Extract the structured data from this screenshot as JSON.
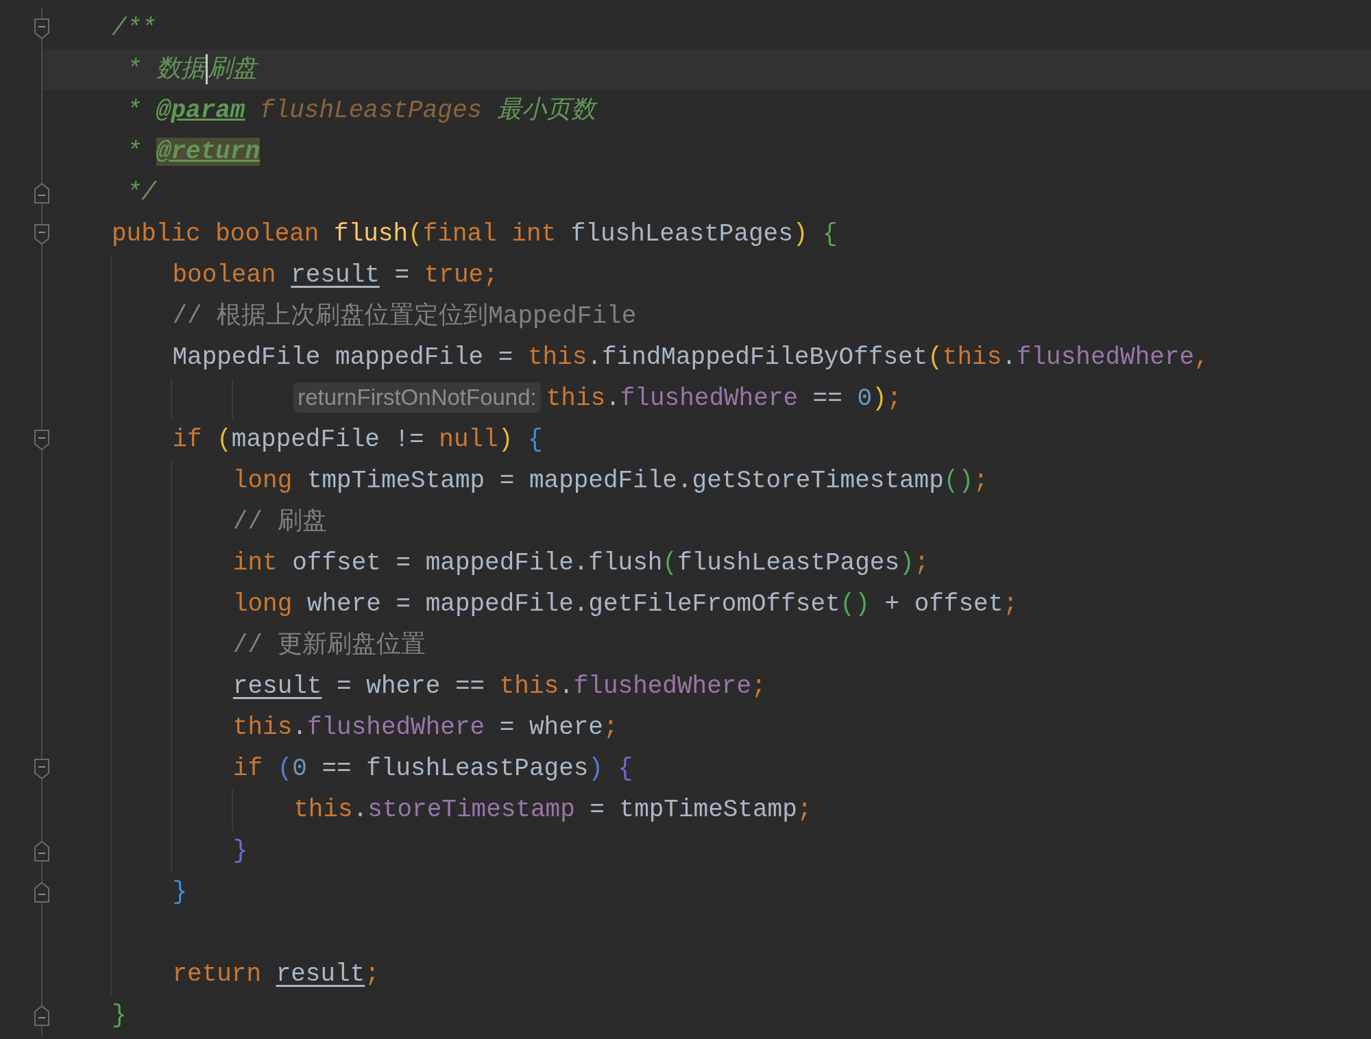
{
  "editor": {
    "lines": [
      {
        "tokens": [
          {
            "kind": "doc",
            "text": "/**"
          }
        ],
        "children": [
          {
            "kind": "doc",
            "current": true,
            "tokens": [
              {
                "kind": "doc",
                "text": "* 数据"
              },
              {
                "kind": "caret"
              },
              {
                "kind": "doc",
                "text": "刷盘"
              }
            ]
          },
          {
            "kind": "doc",
            "tokens": [
              {
                "kind": "doc",
                "text": "* "
              },
              {
                "kind": "doctag",
                "text": "@param",
                "highlighted": false
              },
              {
                "kind": "docparam",
                "text": " flushLeastPages"
              },
              {
                "kind": "doc",
                "text": " 最小页数"
              }
            ]
          },
          {
            "kind": "doc",
            "tokens": [
              {
                "kind": "doc",
                "text": "* "
              },
              {
                "kind": "doctag",
                "text": "@return",
                "highlighted": true
              }
            ]
          },
          {
            "kind": "doc",
            "fold_end": true,
            "tokens": [
              {
                "kind": "doc",
                "text": "*/"
              }
            ]
          }
        ]
      },
      {
        "tokens": [
          {
            "kind": "keyword",
            "text": "public "
          },
          {
            "kind": "keyword",
            "text": "boolean "
          },
          {
            "kind": "method",
            "text": "flush"
          },
          {
            "kind": "bracket",
            "text": "(",
            "color": "#e8ba36"
          },
          {
            "kind": "keyword",
            "text": "final "
          },
          {
            "kind": "keyword",
            "text": "int "
          },
          {
            "kind": "plain",
            "text": "flushLeastPages"
          },
          {
            "kind": "bracket",
            "text": ")",
            "color": "#e8ba36"
          },
          {
            "kind": "bracket",
            "text": " {",
            "color": "#54a857"
          }
        ],
        "children": [
          {
            "kind": "code",
            "tokens": [
              {
                "kind": "keyword",
                "text": "boolean "
              },
              {
                "kind": "variable",
                "text": "result"
              },
              {
                "kind": "plain",
                "text": " = "
              },
              {
                "kind": "keyword",
                "text": "true;"
              }
            ]
          },
          {
            "kind": "code",
            "tokens": [
              {
                "kind": "comment",
                "text": "// 根据上次刷盘位置定位到MappedFile"
              }
            ]
          },
          {
            "kind": "code",
            "tokens": [
              {
                "kind": "plain",
                "text": "MappedFile mappedFile = "
              },
              {
                "kind": "keyword",
                "text": "this"
              },
              {
                "kind": "plain",
                "text": ".findMappedFileByOffset"
              },
              {
                "kind": "bracket",
                "text": "(",
                "color": "#e8ba36"
              },
              {
                "kind": "keyword",
                "text": "this"
              },
              {
                "kind": "plain",
                "text": "."
              },
              {
                "kind": "field",
                "text": "flushedWhere"
              },
              {
                "kind": "keyword",
                "text": ","
              }
            ],
            "children": [
              {
                "kind": "continuation",
                "tokens": [
                  {
                    "kind": "hint",
                    "text": "returnFirstOnNotFound:"
                  },
                  {
                    "kind": "keyword",
                    "text": "this"
                  },
                  {
                    "kind": "plain",
                    "text": "."
                  },
                  {
                    "kind": "field",
                    "text": "flushedWhere"
                  },
                  {
                    "kind": "plain",
                    "text": " == "
                  },
                  {
                    "kind": "number",
                    "text": "0"
                  },
                  {
                    "kind": "bracket",
                    "text": ")",
                    "color": "#e8ba36"
                  },
                  {
                    "kind": "keyword",
                    "text": ";"
                  }
                ]
              }
            ]
          },
          {
            "kind": "code",
            "tokens": [
              {
                "kind": "keyword",
                "text": "if "
              },
              {
                "kind": "bracket",
                "text": "(",
                "color": "#e8ba36"
              },
              {
                "kind": "plain",
                "text": "mappedFile != "
              },
              {
                "kind": "keyword",
                "text": "null"
              },
              {
                "kind": "bracket",
                "text": ")",
                "color": "#e8ba36"
              },
              {
                "kind": "bracket",
                "text": " {",
                "color": "#3d8fe0"
              }
            ],
            "children": [
              {
                "kind": "code",
                "tokens": [
                  {
                    "kind": "keyword",
                    "text": "long "
                  },
                  {
                    "kind": "plain",
                    "text": "tmpTimeStamp = mappedFile.getStoreTimestamp"
                  },
                  {
                    "kind": "bracket",
                    "text": "()",
                    "color": "#54a857"
                  },
                  {
                    "kind": "keyword",
                    "text": ";"
                  }
                ]
              },
              {
                "kind": "code",
                "tokens": [
                  {
                    "kind": "comment",
                    "text": "// 刷盘"
                  }
                ]
              },
              {
                "kind": "code",
                "tokens": [
                  {
                    "kind": "keyword",
                    "text": "int "
                  },
                  {
                    "kind": "plain",
                    "text": "offset = mappedFile.flush"
                  },
                  {
                    "kind": "bracket",
                    "text": "(",
                    "color": "#54a857"
                  },
                  {
                    "kind": "plain",
                    "text": "flushLeastPages"
                  },
                  {
                    "kind": "bracket",
                    "text": ")",
                    "color": "#54a857"
                  },
                  {
                    "kind": "keyword",
                    "text": ";"
                  }
                ]
              },
              {
                "kind": "code",
                "tokens": [
                  {
                    "kind": "keyword",
                    "text": "long "
                  },
                  {
                    "kind": "plain",
                    "text": "where = mappedFile.getFileFromOffset"
                  },
                  {
                    "kind": "bracket",
                    "text": "()",
                    "color": "#54a857"
                  },
                  {
                    "kind": "plain",
                    "text": " + offset"
                  },
                  {
                    "kind": "keyword",
                    "text": ";"
                  }
                ]
              },
              {
                "kind": "code",
                "tokens": [
                  {
                    "kind": "comment",
                    "text": "// 更新刷盘位置"
                  }
                ]
              },
              {
                "kind": "code",
                "tokens": [
                  {
                    "kind": "variable",
                    "text": "result"
                  },
                  {
                    "kind": "plain",
                    "text": " = where == "
                  },
                  {
                    "kind": "keyword",
                    "text": "this"
                  },
                  {
                    "kind": "plain",
                    "text": "."
                  },
                  {
                    "kind": "field",
                    "text": "flushedWhere"
                  },
                  {
                    "kind": "keyword",
                    "text": ";"
                  }
                ]
              },
              {
                "kind": "code",
                "tokens": [
                  {
                    "kind": "keyword",
                    "text": "this"
                  },
                  {
                    "kind": "plain",
                    "text": "."
                  },
                  {
                    "kind": "field",
                    "text": "flushedWhere"
                  },
                  {
                    "kind": "plain",
                    "text": " = where"
                  },
                  {
                    "kind": "keyword",
                    "text": ";"
                  }
                ]
              },
              {
                "kind": "code",
                "tokens": [
                  {
                    "kind": "keyword",
                    "text": "if "
                  },
                  {
                    "kind": "bracket",
                    "text": "(",
                    "color": "#4f7fd6"
                  },
                  {
                    "kind": "number",
                    "text": "0"
                  },
                  {
                    "kind": "plain",
                    "text": " == flushLeastPages"
                  },
                  {
                    "kind": "bracket",
                    "text": ")",
                    "color": "#4f7fd6"
                  },
                  {
                    "kind": "bracket",
                    "text": " {",
                    "color": "#6c6cd8"
                  }
                ],
                "children": [
                  {
                    "kind": "code",
                    "tokens": [
                      {
                        "kind": "keyword",
                        "text": "this"
                      },
                      {
                        "kind": "plain",
                        "text": "."
                      },
                      {
                        "kind": "field",
                        "text": "storeTimestamp"
                      },
                      {
                        "kind": "plain",
                        "text": " = tmpTimeStamp"
                      },
                      {
                        "kind": "keyword",
                        "text": ";"
                      }
                    ]
                  }
                ]
              },
              {
                "kind": "code",
                "fold_end": true,
                "tokens": [
                  {
                    "kind": "bracket",
                    "text": "}",
                    "color": "#6c6cd8"
                  }
                ]
              }
            ]
          },
          {
            "kind": "code",
            "fold_end": true,
            "tokens": [
              {
                "kind": "bracket",
                "text": "}",
                "color": "#3d8fe0"
              }
            ]
          },
          {
            "kind": "code"
          },
          {
            "kind": "code",
            "tokens": [
              {
                "kind": "keyword",
                "text": "return "
              },
              {
                "kind": "variable",
                "text": "result"
              },
              {
                "kind": "keyword",
                "text": ";"
              }
            ]
          }
        ]
      },
      {
        "fold_end": true,
        "tokens": [
          {
            "kind": "bracket",
            "text": "}",
            "color": "#54a857"
          }
        ]
      }
    ]
  }
}
